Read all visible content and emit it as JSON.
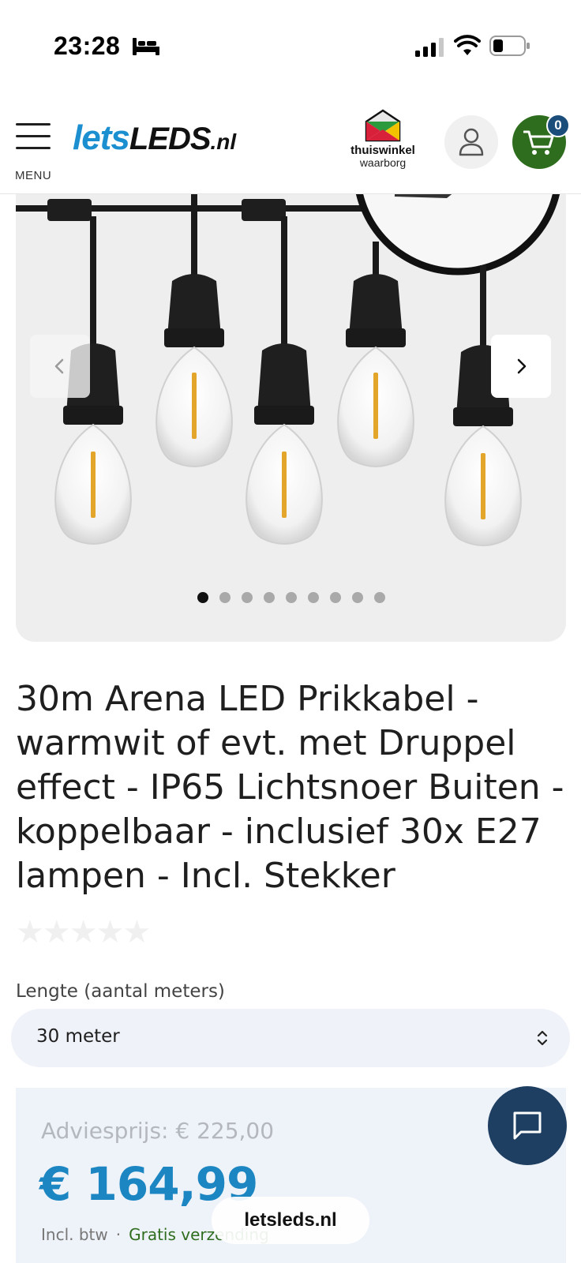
{
  "status_bar": {
    "time": "23:28",
    "icons": [
      "bed-icon",
      "signal-icon",
      "wifi-icon",
      "battery-icon"
    ]
  },
  "header": {
    "menu_label": "MENU",
    "logo_lets": "lets",
    "logo_leds": "LEDS",
    "logo_tld": ".nl",
    "trust_name": "thuiswinkel",
    "trust_sub": "waarborg",
    "cart_count": "0"
  },
  "gallery": {
    "slide_count": 9,
    "active_slide": 1
  },
  "product": {
    "title": "30m Arena LED Prikkabel - warmwit of evt. met Druppel effect - IP65 Lichtsnoer Buiten - koppelbaar - inclusief 30x E27 lampen - Incl. Stekker",
    "rating_stars": "★★★★★"
  },
  "variant": {
    "label": "Lengte (aantal meters)",
    "selected": "30 meter"
  },
  "price": {
    "advice": "Adviesprijs: € 225,00",
    "sale": "€ 164,99",
    "incl_btw": "Incl. btw",
    "separator": "·",
    "shipping": "Gratis verzending"
  },
  "browser": {
    "domain": "letsleds.nl"
  },
  "colors": {
    "brand_blue": "#1b8fcf",
    "cart_green": "#2f6d1e",
    "chat_navy": "#1e3f61",
    "price_blue": "#1c86c2"
  }
}
